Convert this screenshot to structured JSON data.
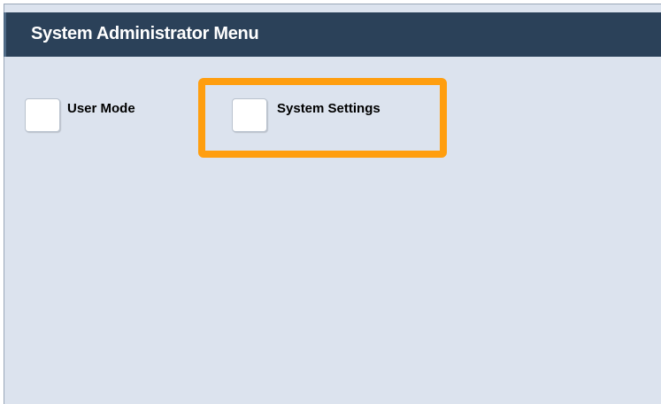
{
  "header": {
    "title": "System Administrator Menu"
  },
  "options": [
    {
      "label": "User Mode",
      "checked": false
    },
    {
      "label": "System Settings",
      "checked": false
    }
  ],
  "highlight": {
    "target": "System Settings",
    "color": "#ff9e0f"
  },
  "colors": {
    "titlebar_bg": "#2b4159",
    "panel_bg": "#dce3ee",
    "title_text": "#ffffff"
  }
}
